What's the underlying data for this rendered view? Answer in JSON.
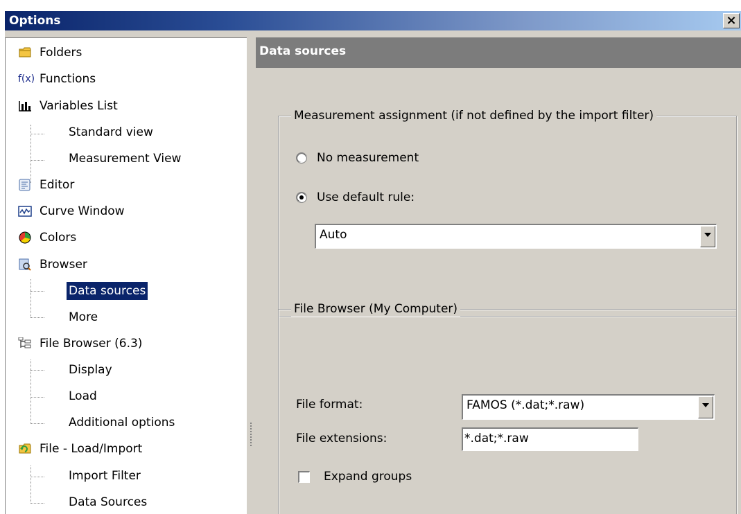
{
  "window": {
    "title": "Options",
    "close_glyph": "×"
  },
  "tree": {
    "items": [
      {
        "label": "Folders",
        "icon": "folder-icon",
        "sub": false
      },
      {
        "label": "Functions",
        "icon": "fx-icon",
        "sub": false
      },
      {
        "label": "Variables List",
        "icon": "variables-list-icon",
        "sub": false
      },
      {
        "label": "Standard view",
        "sub": true
      },
      {
        "label": "Measurement View",
        "sub": true
      },
      {
        "label": "Editor",
        "icon": "editor-icon",
        "sub": false
      },
      {
        "label": "Curve Window",
        "icon": "curve-window-icon",
        "sub": false
      },
      {
        "label": "Colors",
        "icon": "colors-icon",
        "sub": false
      },
      {
        "label": "Browser",
        "icon": "browser-icon",
        "sub": false
      },
      {
        "label": "Data sources",
        "sub": true,
        "selected": true
      },
      {
        "label": "More",
        "sub": true
      },
      {
        "label": "File Browser (6.3)",
        "icon": "file-browser-icon",
        "sub": false
      },
      {
        "label": "Display",
        "sub": true
      },
      {
        "label": "Load",
        "sub": true
      },
      {
        "label": "Additional options",
        "sub": true
      },
      {
        "label": "File - Load/Import",
        "icon": "file-load-import-icon",
        "sub": false
      },
      {
        "label": "Import Filter",
        "sub": true
      },
      {
        "label": "Data Sources",
        "sub": true
      }
    ]
  },
  "panel": {
    "header": "Data sources",
    "measurement_group": {
      "legend": "Measurement assignment (if not defined by the import filter)",
      "option_none": "No measurement",
      "option_default": "Use default rule:",
      "selected_option": "default",
      "rule_value": "Auto"
    },
    "file_browser_group": {
      "legend": "File Browser (My Computer)",
      "file_format_label": "File format:",
      "file_format_value": "FAMOS  (*.dat;*.raw)",
      "file_extensions_label": "File extensions:",
      "file_extensions_value": "*.dat;*.raw",
      "expand_groups_label": "Expand groups",
      "expand_groups_checked": false
    }
  },
  "colors": {
    "title_gradient_start": "#0a246a",
    "title_gradient_end": "#a6caf0",
    "selection": "#0a246a",
    "panel_header": "#7c7c7c",
    "dialog_face": "#d4d0c8"
  }
}
